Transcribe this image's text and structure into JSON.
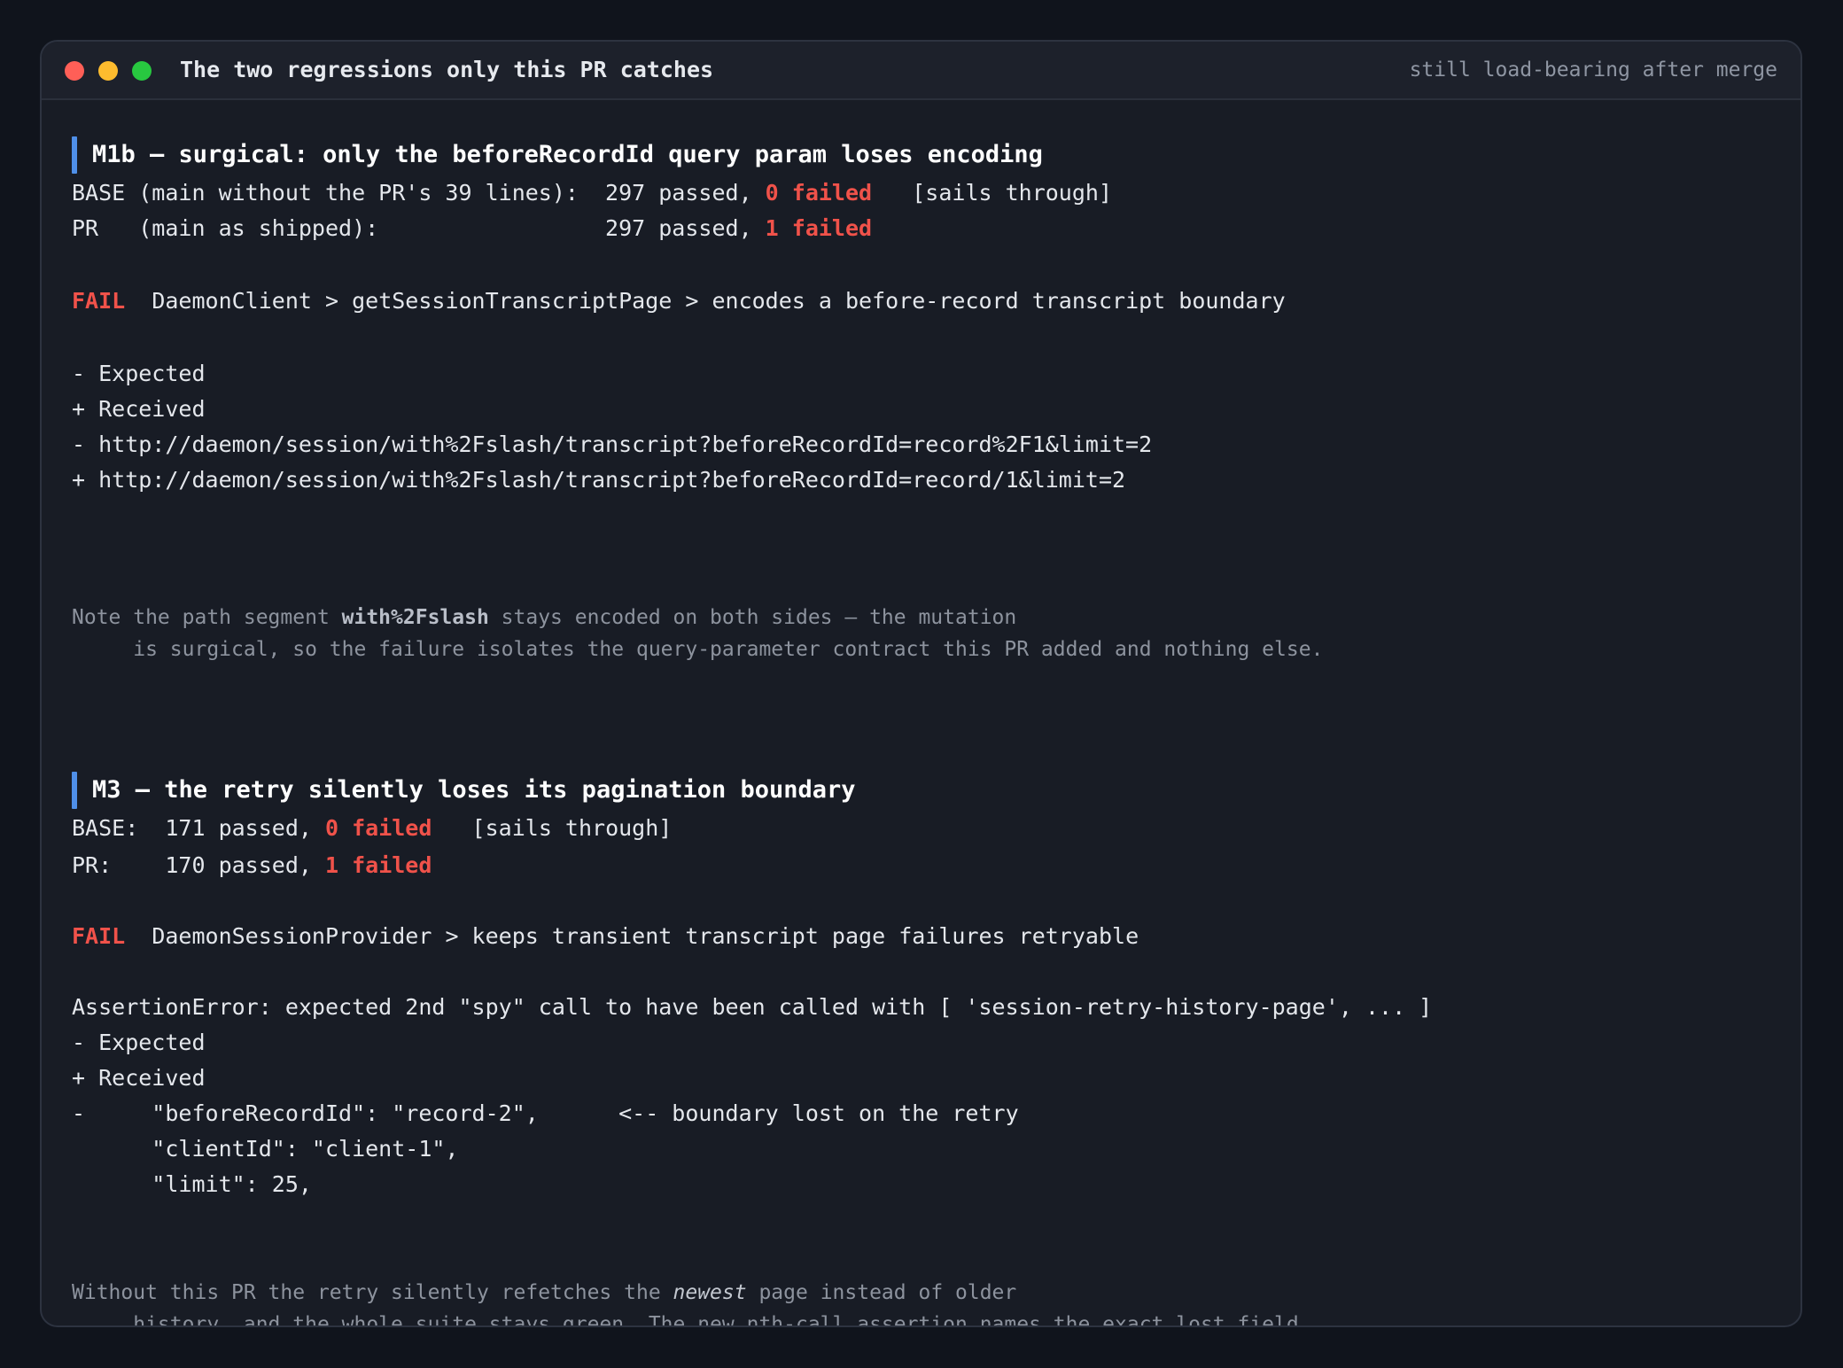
{
  "window": {
    "title": "The two regressions only this PR catches",
    "subtitle": "still load-bearing after merge",
    "controls": [
      "close",
      "minimize",
      "maximize"
    ]
  },
  "sections": [
    {
      "title": "M1b — surgical: only the beforeRecordId query param loses encoding",
      "base_prefix": "BASE (main without the PR's 39 lines):  297 passed, ",
      "base_failed": "0 failed",
      "base_suffix": "   [sails through]",
      "pr_prefix": "PR   (main as shipped):                 297 passed, ",
      "pr_failed": "1 failed",
      "fail_tag": "FAIL",
      "fail_test": "  DaemonClient > getSessionTranscriptPage > encodes a before-record transcript boundary",
      "diff_lines": [
        "- Expected",
        "+ Received",
        "- http://daemon/session/with%2Fslash/transcript?beforeRecordId=record%2F1&limit=2",
        "+ http://daemon/session/with%2Fslash/transcript?beforeRecordId=record/1&limit=2"
      ],
      "note_a": "Note the path segment ",
      "note_bold": "with%2Fslash",
      "note_b": " stays encoded on both sides — the mutation",
      "note_line2": "     is surgical, so the failure isolates the query-parameter contract this PR added and nothing else."
    },
    {
      "title": "M3 — the retry silently loses its pagination boundary",
      "base_prefix": "BASE:  171 passed, ",
      "base_failed": "0 failed",
      "base_suffix": "   [sails through]",
      "pr_prefix": "PR:    170 passed, ",
      "pr_failed": "1 failed",
      "fail_tag": "FAIL",
      "fail_test": "  DaemonSessionProvider > keeps transient transcript page failures retryable",
      "assertion": "AssertionError: expected 2nd \"spy\" call to have been called with [ 'session-retry-history-page', ... ]",
      "diff_lines": [
        "- Expected",
        "+ Received",
        "-     \"beforeRecordId\": \"record-2\",      <-- boundary lost on the retry",
        "      \"clientId\": \"client-1\",",
        "      \"limit\": 25,"
      ],
      "note_a": "Without this PR the retry silently refetches the ",
      "note_italic": "newest",
      "note_b": " page instead of older",
      "note_line2": "     history, and the whole suite stays green. The new nth-call assertion names the exact lost field."
    }
  ]
}
